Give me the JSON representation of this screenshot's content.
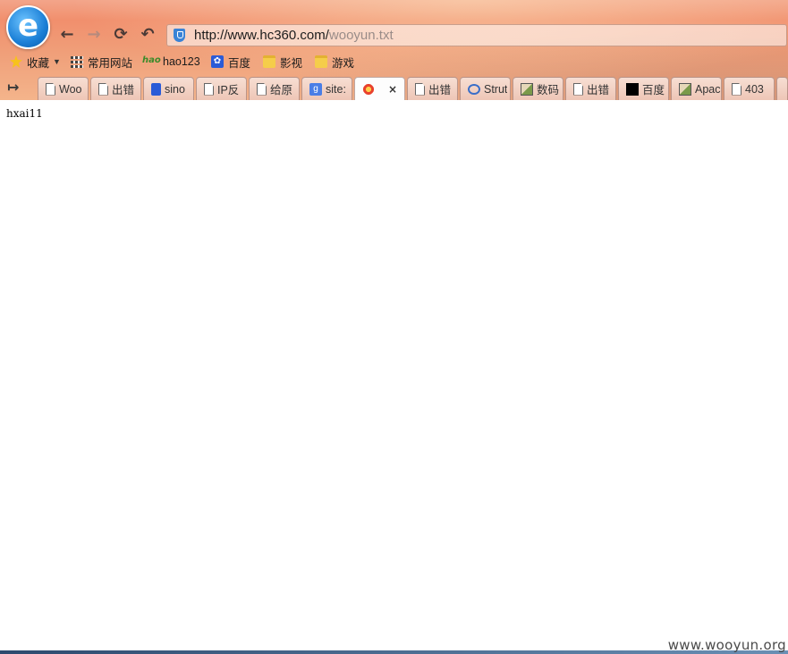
{
  "browser": {
    "logo_letter": "e",
    "address": {
      "url_main": "http://www.hc360.com/",
      "url_faded": "wooyun.txt"
    },
    "bookmarks": [
      {
        "label": "收藏",
        "icon": "star-icon"
      },
      {
        "label": "常用网站",
        "icon": "grid-icon"
      },
      {
        "label": "hao123",
        "icon": "hao123-icon"
      },
      {
        "label": "百度",
        "icon": "baidu-paw-icon"
      },
      {
        "label": "影视",
        "icon": "folder-icon"
      },
      {
        "label": "游戏",
        "icon": "folder-icon"
      }
    ],
    "tabs": [
      {
        "label": "Woo",
        "icon": "page-icon"
      },
      {
        "label": "出错",
        "icon": "page-icon"
      },
      {
        "label": "sino",
        "icon": "baidu-paw-icon"
      },
      {
        "label": "IP反",
        "icon": "page-icon"
      },
      {
        "label": "给原",
        "icon": "page-icon"
      },
      {
        "label": "site:",
        "icon": "google-icon"
      },
      {
        "label": "",
        "icon": "swirl-icon",
        "active": true
      },
      {
        "label": "出错",
        "icon": "page-icon"
      },
      {
        "label": "Strut",
        "icon": "link-icon"
      },
      {
        "label": "数码",
        "icon": "image-icon"
      },
      {
        "label": "出错",
        "icon": "page-icon"
      },
      {
        "label": "百度",
        "icon": "black-square-icon"
      },
      {
        "label": "Apac",
        "icon": "image-icon"
      },
      {
        "label": "403",
        "icon": "page-icon"
      }
    ],
    "close_glyph": "×"
  },
  "page": {
    "body_text": "hxai11"
  },
  "watermark": "www.wooyun.org"
}
